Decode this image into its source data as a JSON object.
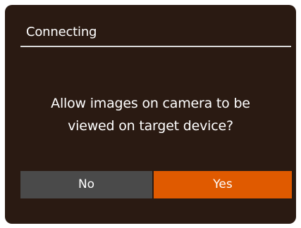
{
  "dialog": {
    "title": "Connecting",
    "message_line1": "Allow images on camera to be",
    "message_line2": "viewed on target device?",
    "no_label": "No",
    "yes_label": "Yes"
  },
  "colors": {
    "background": "#2a1a12",
    "divider": "#d9d9d9",
    "no_button": "#4a4a4a",
    "yes_button_selected": "#e05a00",
    "text": "#ffffff"
  }
}
